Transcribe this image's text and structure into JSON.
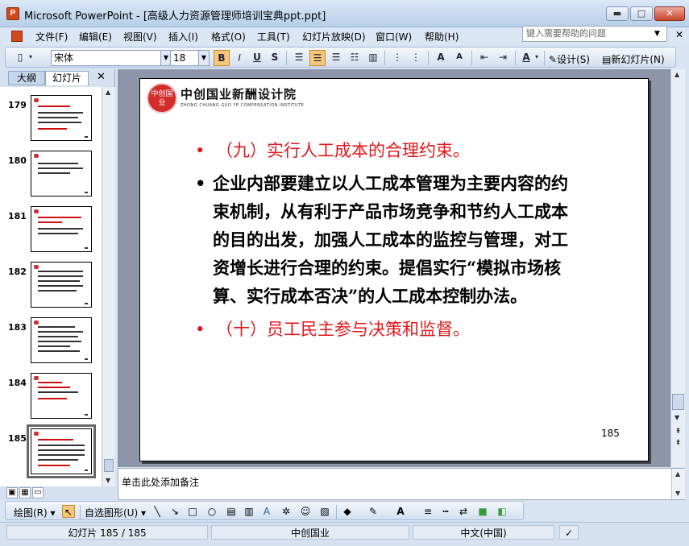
{
  "window": {
    "app_icon_glyph": "P",
    "title": "Microsoft PowerPoint - [高级人力资源管理师培训宝典ppt.ppt]",
    "min_glyph": "▬",
    "max_glyph": "□",
    "close_glyph": "✕"
  },
  "menu": {
    "items": [
      "文件(F)",
      "编辑(E)",
      "视图(V)",
      "插入(I)",
      "格式(O)",
      "工具(T)",
      "幻灯片放映(D)",
      "窗口(W)",
      "帮助(H)"
    ],
    "help_placeholder": "键入需要帮助的问题",
    "close_glyph": "✕"
  },
  "format_toolbar": {
    "font_name": "宋体",
    "font_size": "18",
    "bold": "B",
    "italic": "I",
    "underline": "U",
    "shadow": "S",
    "font_color_glyph": "A",
    "increase_font": "A",
    "decrease_font": "A",
    "design_label": "设计(S)",
    "new_slide_label": "新幻灯片(N)"
  },
  "left_panel": {
    "tab_outline": "大纲",
    "tab_slides": "幻灯片",
    "close_glyph": "✕",
    "thumbnails": [
      {
        "num": "179",
        "style": "red"
      },
      {
        "num": "180",
        "style": "black"
      },
      {
        "num": "181",
        "style": "red"
      },
      {
        "num": "182",
        "style": "black"
      },
      {
        "num": "183",
        "style": "black"
      },
      {
        "num": "184",
        "style": "red"
      },
      {
        "num": "185",
        "style": "red",
        "selected": true
      }
    ]
  },
  "slide": {
    "logo_circle_text": "中创国业",
    "logo_title": "中创国业新酬设计院",
    "logo_subtitle": "ZHONG CHUANG GUO YE COMPENSATION INSTITUTE",
    "bullets": [
      {
        "text": "（九）实行人工成本的合理约束。",
        "color": "red"
      },
      {
        "lines": [
          "企业内部要建立以人工成本管理为主要内容的约",
          "束机制，从有利于产品市场竞争和节约人工成本",
          "的目的出发，加强人工成本的监控与管理，对工",
          "资增长进行合理的约束。提倡实行“模拟市场核",
          "算、实行成本否决”的人工成本控制办法。"
        ],
        "color": "black"
      },
      {
        "text": "（十）员工民主参与决策和监督。",
        "color": "red"
      }
    ],
    "bullet_glyph": "•",
    "page_number": "185"
  },
  "notes": {
    "placeholder": "单击此处添加备注"
  },
  "drawing_toolbar": {
    "draw_label": "绘图(R)",
    "autoshapes_label": "自选图形(U)"
  },
  "status": {
    "slide_position": "幻灯片 185 / 185",
    "design_template": "中创国业",
    "language": "中文(中国)"
  },
  "colors": {
    "accent_red": "#e1171b",
    "toolbar_active": "#f8c77a"
  }
}
